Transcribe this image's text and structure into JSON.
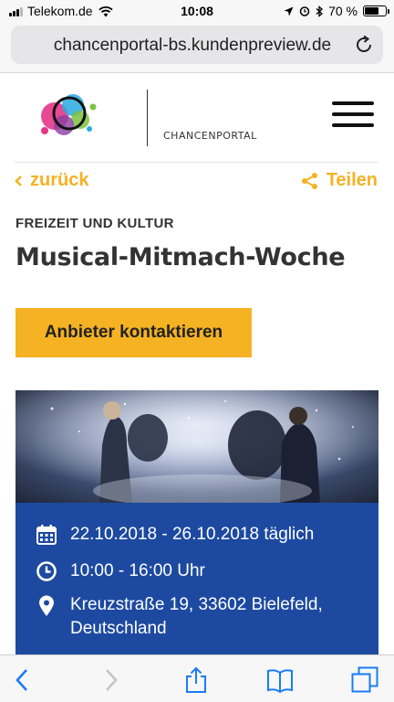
{
  "status_bar": {
    "carrier": "Telekom.de",
    "time": "10:08",
    "battery_percent": "70 %",
    "battery_level": 0.7
  },
  "browser": {
    "url": "chancenportal-bs.kundenpreview.de"
  },
  "header": {
    "brand": "CHANCENPORTAL"
  },
  "nav": {
    "back_label": "zurück",
    "share_label": "Teilen"
  },
  "event": {
    "category": "FREIZEIT UND KULTUR",
    "title": "Musical-Mitmach-Woche",
    "contact_label": "Anbieter kontaktieren",
    "date": "22.10.2018 - 26.10.2018 täglich",
    "time": "10:00 - 16:00 Uhr",
    "address": "Kreuzstraße 19, 33602 Bielefeld, Deutschland"
  },
  "colors": {
    "accent": "#f5b223",
    "info_bg": "#1d4aa0"
  },
  "icons": [
    "signal-icon",
    "wifi-icon",
    "location-arrow-icon",
    "alarm-icon",
    "bluetooth-icon",
    "battery-icon",
    "reload-icon",
    "hamburger-icon",
    "chevron-left-icon",
    "share-icon",
    "calendar-icon",
    "clock-icon",
    "map-pin-icon",
    "back-arrow-icon",
    "forward-arrow-icon",
    "share-sheet-icon",
    "bookmarks-icon",
    "tabs-icon"
  ]
}
